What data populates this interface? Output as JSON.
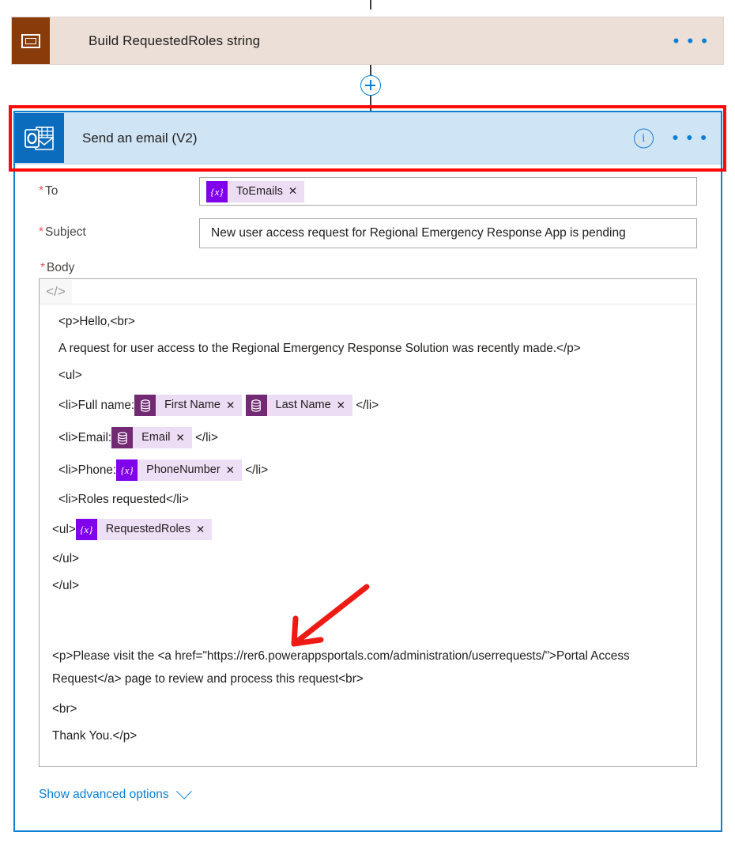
{
  "flow": {
    "previous_action": {
      "title": "Build RequestedRoles string",
      "icon": "variables-icon",
      "menu": "• • •"
    },
    "connector": {
      "add_step_icon": "plus-icon"
    },
    "action": {
      "title": "Send an email (V2)",
      "icon": "outlook-icon",
      "info_icon": "i",
      "menu": "• • •",
      "highlight_color": "#fb0b07",
      "selected_border_color": "#0b7fd4",
      "header_background": "#cfe4f5"
    }
  },
  "form": {
    "to": {
      "label": "To",
      "required_marker": "*",
      "tokens": [
        {
          "icon": "variable-token-icon",
          "glyph": "{x}",
          "label": "ToEmails",
          "remove": "✕",
          "kind": "var"
        }
      ]
    },
    "subject": {
      "label": "Subject",
      "required_marker": "*",
      "value": "New user access request for Regional Emergency Response App is pending"
    },
    "body": {
      "label": "Body",
      "required_marker": "*",
      "toolbar": {
        "code_view_glyph": "</>"
      },
      "lines": [
        {
          "id": "l1",
          "indent": 1,
          "text": "<p>Hello,<br>"
        },
        {
          "id": "l2",
          "indent": 1,
          "text": "A request for user access to the Regional Emergency Response Solution was recently made.</p>"
        },
        {
          "id": "l3",
          "indent": 1,
          "text": "<ul>"
        },
        {
          "id": "l4",
          "indent": 1,
          "pre": "<li>Full name:",
          "post": "</li>",
          "tokens": [
            {
              "kind": "data",
              "glyph": "⛃",
              "label": "First Name",
              "remove": "✕"
            },
            {
              "kind": "data",
              "glyph": "⛃",
              "label": "Last Name",
              "remove": "✕"
            }
          ]
        },
        {
          "id": "l5",
          "indent": 1,
          "pre": "<li>Email:",
          "post": "</li>",
          "tokens": [
            {
              "kind": "data",
              "glyph": "⛃",
              "label": "Email",
              "remove": "✕"
            }
          ]
        },
        {
          "id": "l6",
          "indent": 1,
          "pre": "<li>Phone:",
          "post": "</li>",
          "tokens": [
            {
              "kind": "var",
              "glyph": "{x}",
              "label": "PhoneNumber",
              "remove": "✕"
            }
          ]
        },
        {
          "id": "l7",
          "indent": 1,
          "text": "<li>Roles requested</li>"
        },
        {
          "id": "l8",
          "indent": 0,
          "pre": "<ul>",
          "post": "",
          "tokens": [
            {
              "kind": "var",
              "glyph": "{x}",
              "label": "RequestedRoles",
              "remove": "✕"
            }
          ]
        },
        {
          "id": "l9",
          "indent": 0,
          "text": "</ul>"
        },
        {
          "id": "l10",
          "indent": 0,
          "text": "</ul>"
        },
        {
          "id": "l11",
          "indent": 0,
          "text": ""
        },
        {
          "id": "l12",
          "indent": 0,
          "wrap": true,
          "text": "<p>Please visit the <a href=\"https://rer6.powerappsportals.com/administration/userrequests/\">Portal Access Request</a> page to review and process this request<br>"
        },
        {
          "id": "l13",
          "indent": 0,
          "text": "<br>"
        },
        {
          "id": "l14",
          "indent": 0,
          "text": "Thank You.</p>"
        }
      ]
    },
    "advanced_options": {
      "label": "Show advanced options",
      "chevron": "chevron-down-icon"
    }
  },
  "annotation": {
    "arrow_color": "#ee1b15",
    "points_to": "portal link url"
  }
}
